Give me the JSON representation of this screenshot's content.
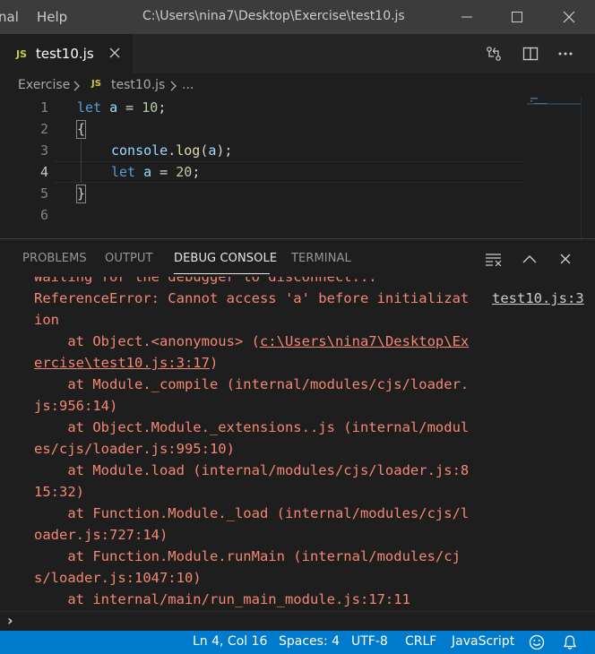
{
  "titlebar": {
    "menu": [
      "nal",
      "Help"
    ],
    "title": "C:\\Users\\nina7\\Desktop\\Exercise\\test10.js"
  },
  "tab": {
    "badge": "JS",
    "label": "test10.js"
  },
  "breadcrumb": {
    "folder": "Exercise",
    "badge": "JS",
    "file": "test10.js",
    "more": "..."
  },
  "editor": {
    "lines": [
      {
        "num": "1"
      },
      {
        "num": "2"
      },
      {
        "num": "3"
      },
      {
        "num": "4"
      },
      {
        "num": "5"
      },
      {
        "num": "6"
      }
    ],
    "tokens": {
      "l1_let": "let",
      "l1_a": "a",
      "l1_eq": " = ",
      "l1_num": "10",
      "l1_semi": ";",
      "l2_brace": "{",
      "l3_console": "console",
      "l3_dot": ".",
      "l3_log": "log",
      "l3_open": "(",
      "l3_a": "a",
      "l3_close": ");",
      "l4_let": "let",
      "l4_a": "a",
      "l4_eq": " = ",
      "l4_num": "20",
      "l4_semi": ";",
      "l5_brace": "}"
    }
  },
  "panel": {
    "tabs": [
      "PROBLEMS",
      "OUTPUT",
      "DEBUG CONSOLE",
      "TERMINAL"
    ],
    "output": {
      "line0": "Waiting for the debugger to disconnect...",
      "line1": "ReferenceError: Cannot access 'a' before initializat",
      "source_link": "test10.js:3",
      "line2": "ion",
      "line3_pre": "    at Object.<anonymous> (",
      "line3_link": "c:\\Users\\nina7\\Desktop\\Ex",
      "line4_link": "ercise\\test10.js:3:17",
      "line4_post": ")",
      "line5": "    at Module._compile (internal/modules/cjs/loader.",
      "line6": "js:956:14)",
      "line7": "    at Object.Module._extensions..js (internal/modul",
      "line8": "es/cjs/loader.js:995:10)",
      "line9": "    at Module.load (internal/modules/cjs/loader.js:8",
      "line10": "15:32)",
      "line11": "    at Function.Module._load (internal/modules/cjs/l",
      "line12": "oader.js:727:14)",
      "line13": "    at Function.Module.runMain (internal/modules/cj",
      "line14": "s/loader.js:1047:10)",
      "line15": "    at internal/main/run_main_module.js:17:11"
    },
    "repl_prompt": "›"
  },
  "statusbar": {
    "position": "Ln 4, Col 16",
    "spaces": "Spaces: 4",
    "encoding": "UTF-8",
    "eol": "CRLF",
    "language": "JavaScript"
  },
  "colors": {
    "accent": "#007acc",
    "error_text": "#f48771",
    "keyword": "#569cd6",
    "variable": "#9cdcfe",
    "function": "#dcdcaa",
    "number": "#b5cea8"
  }
}
